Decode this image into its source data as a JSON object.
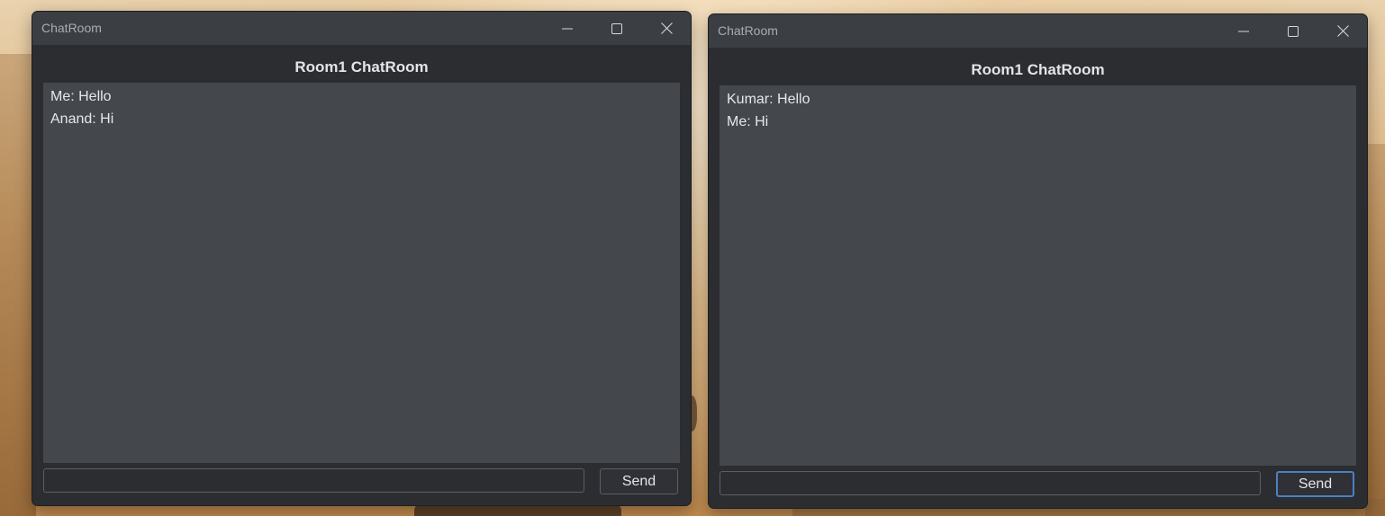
{
  "windows": [
    {
      "title": "ChatRoom",
      "room_title": "Room1 ChatRoom",
      "messages": [
        "Me: Hello",
        "Anand: Hi"
      ],
      "input_value": "",
      "send_label": "Send"
    },
    {
      "title": "ChatRoom",
      "room_title": "Room1 ChatRoom",
      "messages": [
        "Kumar: Hello",
        "Me: Hi"
      ],
      "input_value": "",
      "send_label": "Send"
    }
  ],
  "icons": {
    "minimize": "minimize-icon",
    "maximize": "maximize-icon",
    "close": "close-icon"
  },
  "colors": {
    "window_bg": "#2b2d31",
    "titlebar_bg": "#3b3e43",
    "chat_bg": "#44474c",
    "focus_accent": "#4d7fc4"
  }
}
